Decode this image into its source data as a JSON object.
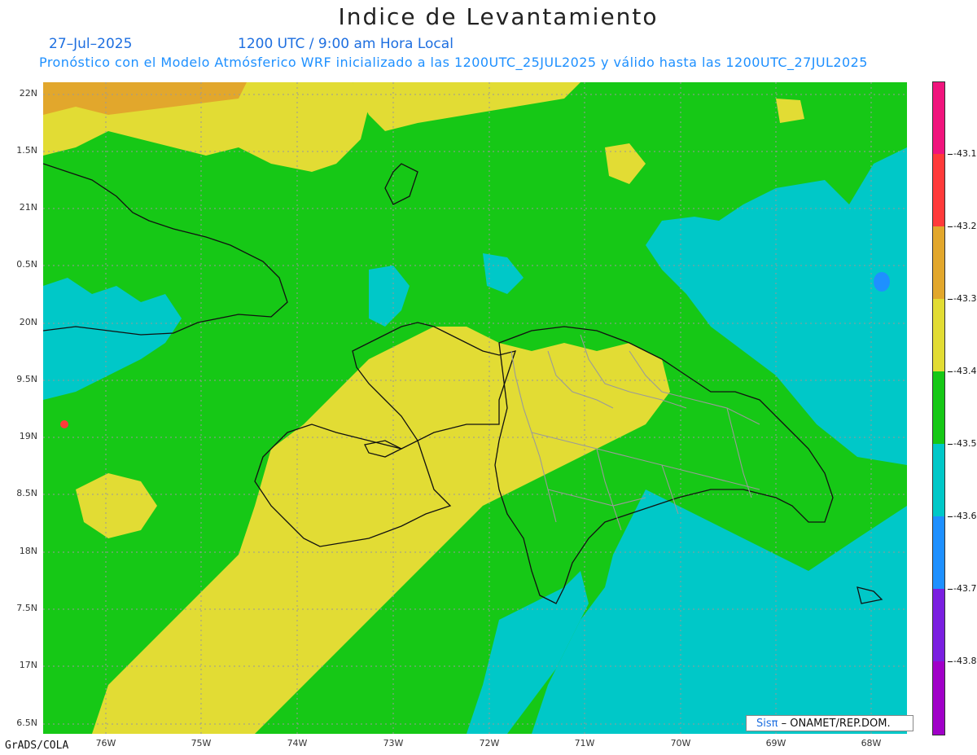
{
  "title": "Indice de Levantamiento",
  "date": "27–Jul–2025",
  "time_line": "1200 UTC / 9:00 am Hora Local",
  "forecast_line": "Pronóstico con el Modelo Atmósferico WRF inicializado a las 1200UTC_25JUL2025 y válido hasta las  1200UTC_27JUL2025",
  "lat_labels": [
    "22N",
    "1.5N",
    "21N",
    "0.5N",
    "20N",
    "9.5N",
    "19N",
    "8.5N",
    "18N",
    "7.5N",
    "17N",
    "6.5N"
  ],
  "lon_labels": [
    "76W",
    "75W",
    "74W",
    "73W",
    "72W",
    "71W",
    "70W",
    "69W",
    "68W"
  ],
  "colorbar": {
    "labels": [
      "-43.1",
      "-43.2",
      "-43.3",
      "-43.4",
      "-43.5",
      "-43.6",
      "-43.7",
      "-43.8"
    ],
    "colors": [
      "#f0147d",
      "#ff3a3a",
      "#e2a72c",
      "#e2dc34",
      "#16c816",
      "#00c8c8",
      "#1e90ff",
      "#7a1fe0",
      "#a000c8"
    ]
  },
  "map_colors": {
    "green": "#16c816",
    "yellow": "#e2dc34",
    "orange": "#e2a72c",
    "cyan": "#00c8c8",
    "blue": "#1e90ff",
    "red": "#ff3a3a"
  },
  "credits": {
    "left": "GrADS/COLA",
    "sis": "Sisπ",
    "org": "– ONAMET/REP.DOM."
  }
}
